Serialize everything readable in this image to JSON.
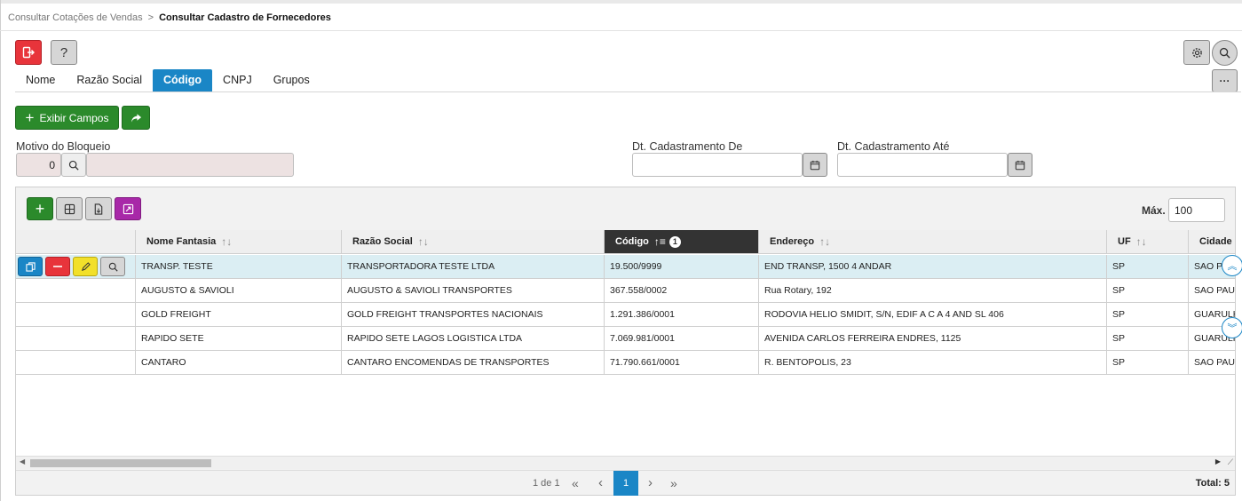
{
  "breadcrumb": {
    "parent": "Consultar Cotações de Vendas",
    "separator": ">",
    "current": "Consultar Cadastro de Fornecedores"
  },
  "toolbar": {
    "help_label": "?",
    "more_label": "···"
  },
  "tabs": [
    {
      "label": "Nome"
    },
    {
      "label": "Razão Social"
    },
    {
      "label": "Código",
      "active": true
    },
    {
      "label": "CNPJ"
    },
    {
      "label": "Grupos"
    }
  ],
  "actions": {
    "exibir_campos": "Exibir Campos"
  },
  "filters": {
    "motivo_label": "Motivo do Bloqueio",
    "motivo_code": "0",
    "motivo_desc": "",
    "dt_de_label": "Dt. Cadastramento De",
    "dt_de_value": "",
    "dt_ate_label": "Dt. Cadastramento Até",
    "dt_ate_value": ""
  },
  "grid": {
    "max_label": "Máx.",
    "max_value": "100",
    "columns": {
      "nome_fantasia": "Nome Fantasia",
      "razao_social": "Razão Social",
      "codigo": "Código",
      "endereco": "Endereço",
      "uf": "UF",
      "cidade": "Cidade"
    },
    "sort_badge": "1",
    "rows": [
      {
        "nome_fantasia": "TRANSP. TESTE",
        "razao_social": "TRANSPORTADORA TESTE  LTDA",
        "codigo": "19.500/9999",
        "endereco": "END TRANSP, 1500 4 ANDAR",
        "uf": "SP",
        "cidade": "SAO PAULO"
      },
      {
        "nome_fantasia": "AUGUSTO & SAVIOLI",
        "razao_social": "AUGUSTO & SAVIOLI TRANSPORTES",
        "codigo": "367.558/0002",
        "endereco": "Rua Rotary, 192",
        "uf": "SP",
        "cidade": "SAO PAULO"
      },
      {
        "nome_fantasia": "GOLD FREIGHT",
        "razao_social": "GOLD FREIGHT TRANSPORTES NACIONAIS",
        "codigo": "1.291.386/0001",
        "endereco": "RODOVIA HELIO SMIDIT, S/N, EDIF A C A 4 AND SL 406",
        "uf": "SP",
        "cidade": "GUARULHOS"
      },
      {
        "nome_fantasia": "RAPIDO SETE",
        "razao_social": "RAPIDO SETE LAGOS LOGISTICA LTDA",
        "codigo": "7.069.981/0001",
        "endereco": "AVENIDA CARLOS FERREIRA ENDRES, 1125",
        "uf": "SP",
        "cidade": "GUARULHOS"
      },
      {
        "nome_fantasia": "CANTARO",
        "razao_social": "CANTARO ENCOMENDAS DE TRANSPORTES",
        "codigo": "71.790.661/0001",
        "endereco": "R. BENTOPOLIS, 23",
        "uf": "SP",
        "cidade": "SAO PAULO"
      }
    ]
  },
  "pagination": {
    "info": "1 de 1",
    "first": "«",
    "prev": "‹",
    "current": "1",
    "next": "›",
    "last": "»",
    "total": "Total: 5"
  },
  "colors": {
    "accent": "#1a86c6",
    "danger": "#e8343b",
    "success": "#2b8a2b",
    "purple": "#a828a8",
    "warning": "#f2e02a"
  }
}
